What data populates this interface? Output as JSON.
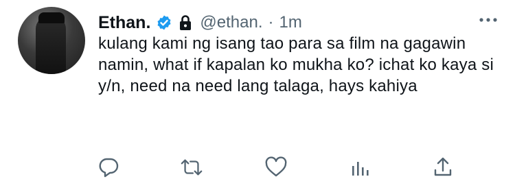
{
  "tweet": {
    "display_name": "Ethan.",
    "handle": "@ethan.",
    "separator": "·",
    "time": "1m",
    "text": "kulang kami ng isang tao para sa film na gagawin namin, what if kapalan ko mukha ko? ichat ko kaya si y/n, need na need lang talaga, hays kahiya"
  },
  "icons": {
    "verified": "verified-badge-icon",
    "protected": "lock-icon",
    "more": "more-dots-icon",
    "actions": [
      "reply-icon",
      "retweet-icon",
      "like-icon",
      "analytics-icon",
      "share-icon"
    ]
  },
  "colors": {
    "text": "#0f1419",
    "secondary": "#536471",
    "verified": "#1d9bf0"
  }
}
